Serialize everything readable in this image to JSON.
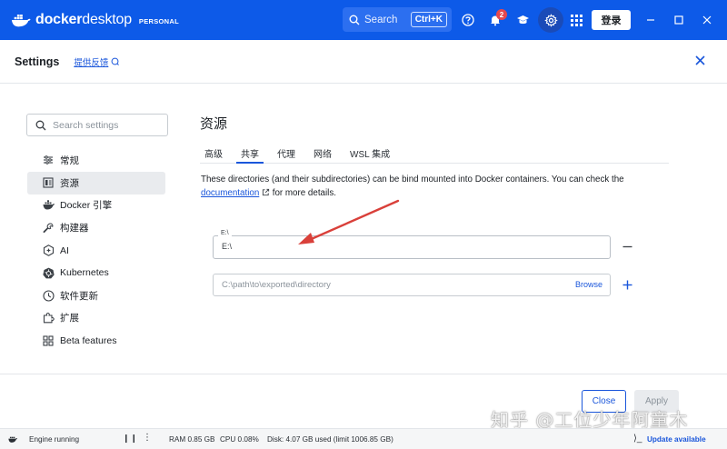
{
  "titlebar": {
    "brand_bold": "docker",
    "brand_thin": "desktop",
    "tier": "PERSONAL",
    "search_label": "Search",
    "search_shortcut": "Ctrl+K",
    "notification_count": "2",
    "signin_label": "登录",
    "accent_color": "#0d5ae8"
  },
  "header": {
    "title": "Settings",
    "feedback_label": "提供反馈"
  },
  "sidebar": {
    "search_placeholder": "Search settings",
    "items": [
      {
        "label": "常规",
        "icon": "sliders-icon",
        "active": false
      },
      {
        "label": "资源",
        "icon": "resources-icon",
        "active": true
      },
      {
        "label": "Docker 引擎",
        "icon": "whale-icon",
        "active": false
      },
      {
        "label": "构建器",
        "icon": "wrench-icon",
        "active": false
      },
      {
        "label": "AI",
        "icon": "ai-icon",
        "active": false
      },
      {
        "label": "Kubernetes",
        "icon": "kubernetes-icon",
        "active": false
      },
      {
        "label": "软件更新",
        "icon": "clock-icon",
        "active": false
      },
      {
        "label": "扩展",
        "icon": "puzzle-icon",
        "active": false
      },
      {
        "label": "Beta features",
        "icon": "beta-icon",
        "active": false
      }
    ]
  },
  "main": {
    "title": "资源",
    "tabs": [
      {
        "label": "高级",
        "active": false
      },
      {
        "label": "共享",
        "active": true
      },
      {
        "label": "代理",
        "active": false
      },
      {
        "label": "网络",
        "active": false
      },
      {
        "label": "WSL 集成",
        "active": false
      }
    ],
    "description_before": "These directories (and their subdirectories) can be bind mounted into Docker containers. You can check the ",
    "description_link": "documentation",
    "description_after": " for more details.",
    "shared_dir_label": "E:\\",
    "shared_dir_value": "E:\\",
    "new_dir_placeholder": "C:\\path\\to\\exported\\directory",
    "browse_label": "Browse",
    "close_label": "Close",
    "apply_label": "Apply"
  },
  "watermark": "知乎 @工位少年阿童木",
  "statusbar": {
    "engine": "Engine running",
    "pause": "❙❙",
    "more": "⋮",
    "ram": "RAM 0.85 GB",
    "cpu": "CPU 0.08%",
    "disk": "Disk: 4.07 GB used (limit 1006.85 GB)",
    "terminal": "⟩_",
    "update": "Update available"
  }
}
